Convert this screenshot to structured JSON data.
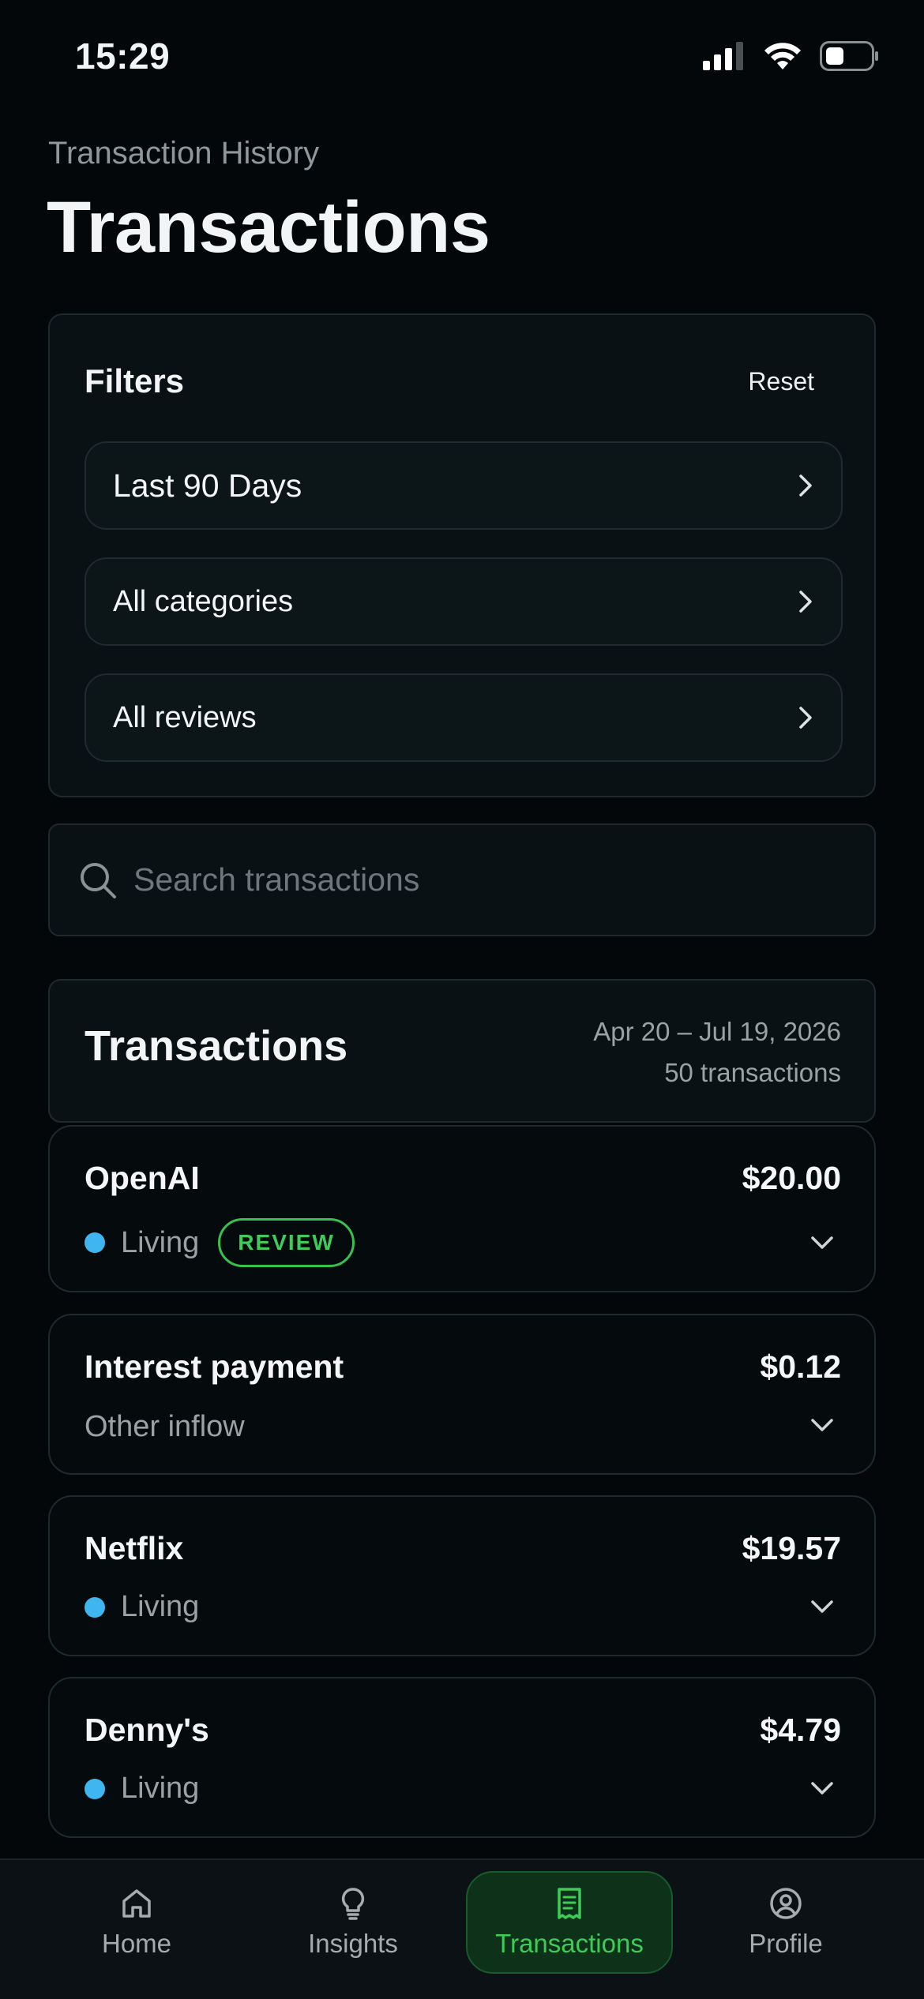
{
  "status_bar": {
    "time": "15:29"
  },
  "header": {
    "subtitle": "Transaction History",
    "title": "Transactions"
  },
  "filters": {
    "title": "Filters",
    "reset_label": "Reset",
    "rows": [
      {
        "label": "Last 90 Days"
      },
      {
        "label": "All categories"
      },
      {
        "label": "All reviews"
      }
    ]
  },
  "search": {
    "placeholder": "Search transactions",
    "value": ""
  },
  "transactions": {
    "title": "Transactions",
    "date_range": "Apr 20 – Jul 19, 2026",
    "count_label": "50 transactions",
    "items": [
      {
        "name": "OpenAI",
        "amount": "$20.00",
        "category": "Living",
        "badge": "REVIEW"
      },
      {
        "name": "Interest payment",
        "amount": "$0.12",
        "category": "Other inflow"
      },
      {
        "name": "Netflix",
        "amount": "$19.57",
        "category": "Living"
      },
      {
        "name": "Denny's",
        "amount": "$4.79",
        "category": "Living"
      }
    ]
  },
  "nav": {
    "items": [
      {
        "label": "Home",
        "icon": "home-icon"
      },
      {
        "label": "Insights",
        "icon": "lightbulb-icon"
      },
      {
        "label": "Transactions",
        "icon": "receipt-icon",
        "active": true
      },
      {
        "label": "Profile",
        "icon": "profile-icon"
      }
    ]
  },
  "colors": {
    "background": "#030709",
    "accent": "#3ecb57",
    "living_dot": "#3fb6f0",
    "card": "#0a1114"
  }
}
